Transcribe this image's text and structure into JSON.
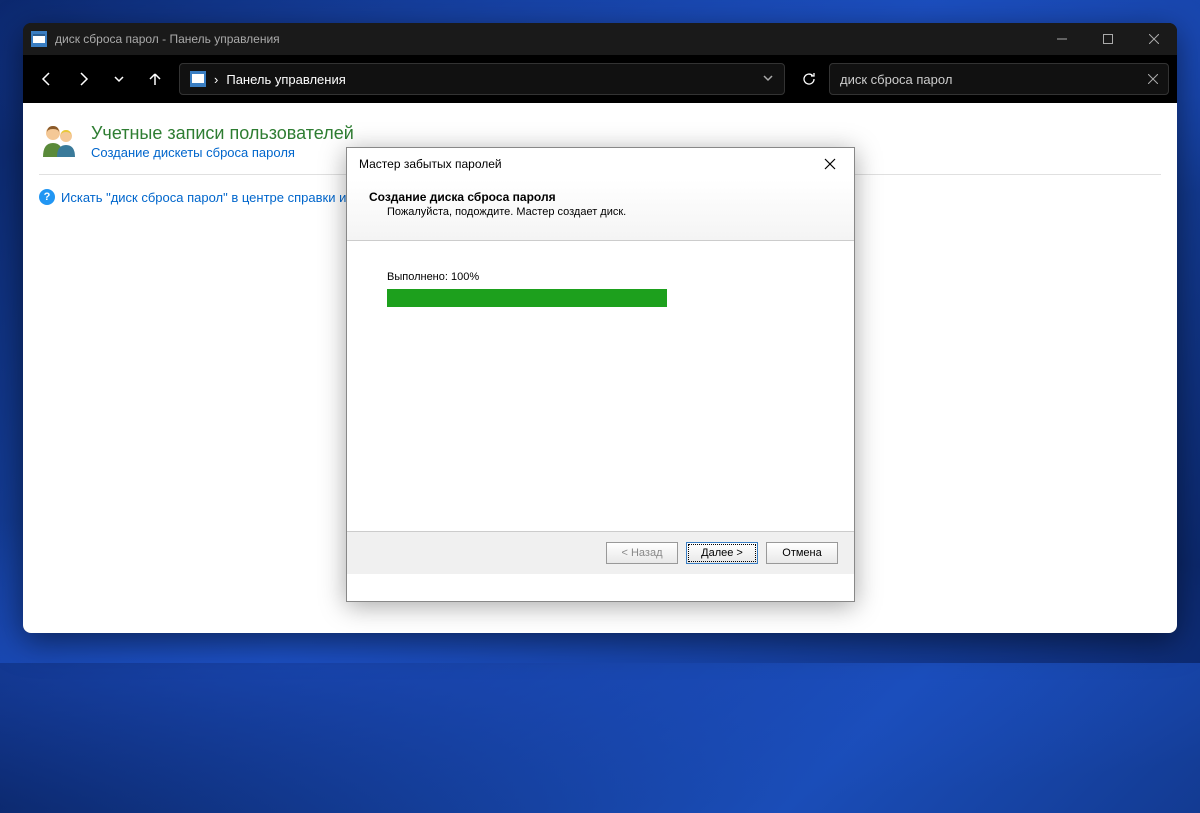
{
  "window": {
    "title": "диск сброса парол - Панель управления"
  },
  "addressbar": {
    "path": "Панель управления",
    "separator": "›"
  },
  "search": {
    "value": "диск сброса парол"
  },
  "content": {
    "heading": "Учетные записи пользователей",
    "sublink": "Создание дискеты сброса пароля",
    "help_link": "Искать \"диск сброса парол\" в центре справки и по"
  },
  "wizard": {
    "title": "Мастер забытых паролей",
    "step_title": "Создание диска сброса пароля",
    "step_desc": "Пожалуйста, подождите. Мастер создает диск.",
    "progress_label": "Выполнено: 100%",
    "progress_value": 100,
    "buttons": {
      "back": "< Назад",
      "next": "Далее >",
      "cancel": "Отмена"
    }
  }
}
